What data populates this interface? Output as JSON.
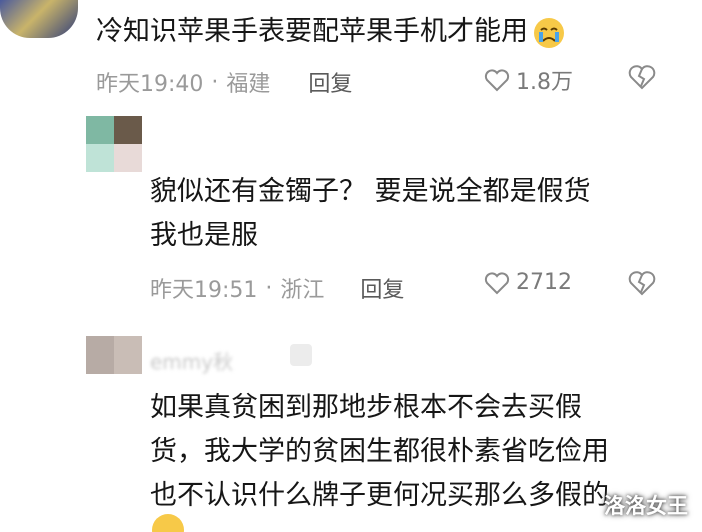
{
  "comments": [
    {
      "text_lines": [
        "冷知识苹果手表要配苹果手机才能用"
      ],
      "emoji": "crying-face-emoji",
      "time": "昨天19:40",
      "location": "福建",
      "reply_label": "回复",
      "likes": "1.8万"
    },
    {
      "text_lines": [
        "貌似还有金镯子？  要是说全都是假货",
        "我也是服"
      ],
      "time": "昨天19:51",
      "location": "浙江",
      "reply_label": "回复",
      "likes": "2712"
    },
    {
      "username": "emmy秋",
      "text_lines": [
        "如果真贫困到那地步根本不会去买假",
        "货，我大学的贫困生都很朴素省吃俭用",
        "也不认识什么牌子更何况买那么多假的"
      ]
    }
  ],
  "watermark": "洛洛女王",
  "colors": {
    "text": "#161616",
    "meta": "#9a9a9a",
    "reply": "#5a5a5a",
    "background": "#ffffff"
  }
}
